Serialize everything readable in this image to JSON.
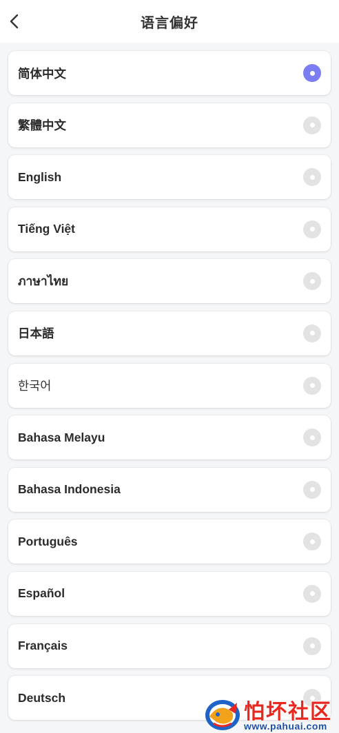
{
  "header": {
    "title": "语言偏好",
    "back_icon": "chevron-left-icon"
  },
  "languages": [
    {
      "label": "简体中文",
      "selected": true
    },
    {
      "label": "繁體中文",
      "selected": false
    },
    {
      "label": "English",
      "selected": false
    },
    {
      "label": "Tiếng Việt",
      "selected": false
    },
    {
      "label": "ภาษาไทย",
      "selected": false
    },
    {
      "label": "日本語",
      "selected": false
    },
    {
      "label": "한국어",
      "selected": false
    },
    {
      "label": "Bahasa Melayu",
      "selected": false
    },
    {
      "label": "Bahasa Indonesia",
      "selected": false
    },
    {
      "label": "Português",
      "selected": false
    },
    {
      "label": "Español",
      "selected": false
    },
    {
      "label": "Français",
      "selected": false
    },
    {
      "label": "Deutsch",
      "selected": false
    }
  ],
  "colors": {
    "accent": "#7b7ef2",
    "radio_unselected": "#e3e3e3",
    "background": "#f5f6f8"
  },
  "watermark": {
    "title": "怕坏社区",
    "url": "www.pahuai.com"
  }
}
